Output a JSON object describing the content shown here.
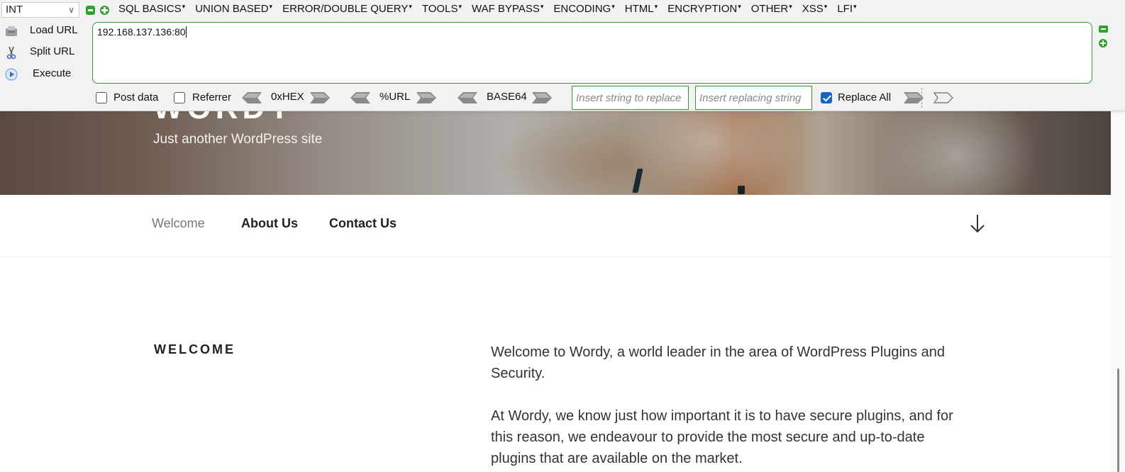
{
  "hackbar": {
    "type_select": "INT",
    "menus": [
      "SQL BASICS",
      "UNION BASED",
      "ERROR/DOUBLE QUERY",
      "TOOLS",
      "WAF BYPASS",
      "ENCODING",
      "HTML",
      "ENCRYPTION",
      "OTHER",
      "XSS",
      "LFI"
    ],
    "load_url": "Load URL",
    "split_url": "Split URL",
    "execute": "Execute",
    "url_value": "192.168.137.136:80",
    "post_data": "Post data",
    "referrer": "Referrer",
    "hex": "0xHEX",
    "url_enc": "%URL",
    "base64": "BASE64",
    "replace_placeholder": "Insert string to replace",
    "replacing_placeholder": "Insert replacing string",
    "replace_all": "Replace All",
    "post_data_checked": false,
    "referrer_checked": false,
    "replace_all_checked": true,
    "accent_color": "#2e9a2e"
  },
  "site": {
    "title": "WORDY",
    "description": "Just another WordPress site",
    "nav": [
      "Welcome",
      "About Us",
      "Contact Us"
    ],
    "section_title": "WELCOME",
    "para1": "Welcome to Wordy, a world leader in the area of WordPress Plugins and Security.",
    "para2": "At Wordy, we know just how important it is to have secure plugins, and for this reason, we endeavour to provide the most secure and up-to-date plugins that are available on the market."
  }
}
